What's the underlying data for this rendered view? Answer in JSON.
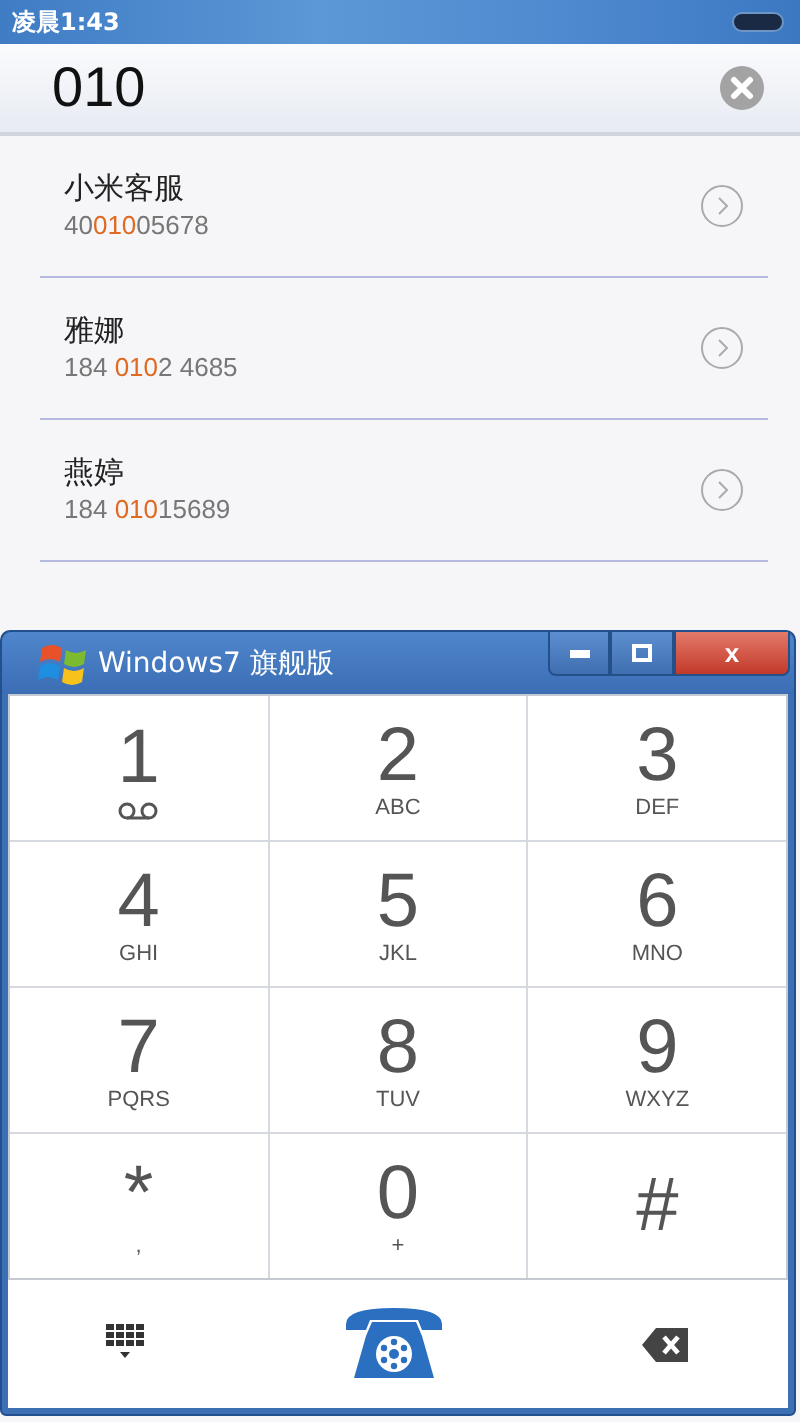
{
  "status_bar": {
    "time": "凌晨1:43"
  },
  "search": {
    "value": "010"
  },
  "contacts": [
    {
      "name": "小米客服",
      "number_parts": [
        {
          "text": "40",
          "highlight": false
        },
        {
          "text": "010",
          "highlight": true
        },
        {
          "text": "05678",
          "highlight": false
        }
      ]
    },
    {
      "name": "雅娜",
      "number_parts": [
        {
          "text": "184 ",
          "highlight": false
        },
        {
          "text": "010",
          "highlight": true
        },
        {
          "text": "2 4685",
          "highlight": false
        }
      ]
    },
    {
      "name": "燕婷",
      "number_parts": [
        {
          "text": "184 ",
          "highlight": false
        },
        {
          "text": "010",
          "highlight": true
        },
        {
          "text": "15689",
          "highlight": false
        }
      ]
    }
  ],
  "window": {
    "title": "Windows7 旗舰版",
    "close_label": "x"
  },
  "keys": [
    {
      "digit": "1",
      "kind": "voicemail"
    },
    {
      "digit": "2",
      "kind": "letters",
      "sub": "ABC"
    },
    {
      "digit": "3",
      "kind": "letters",
      "sub": "DEF"
    },
    {
      "digit": "4",
      "kind": "letters",
      "sub": "GHI"
    },
    {
      "digit": "5",
      "kind": "letters",
      "sub": "JKL"
    },
    {
      "digit": "6",
      "kind": "letters",
      "sub": "MNO"
    },
    {
      "digit": "7",
      "kind": "letters",
      "sub": "PQRS"
    },
    {
      "digit": "8",
      "kind": "letters",
      "sub": "TUV"
    },
    {
      "digit": "9",
      "kind": "letters",
      "sub": "WXYZ"
    },
    {
      "digit": "*",
      "kind": "letters",
      "sub": ","
    },
    {
      "digit": "0",
      "kind": "letters",
      "sub": "+"
    },
    {
      "digit": "#",
      "kind": "plain"
    }
  ]
}
